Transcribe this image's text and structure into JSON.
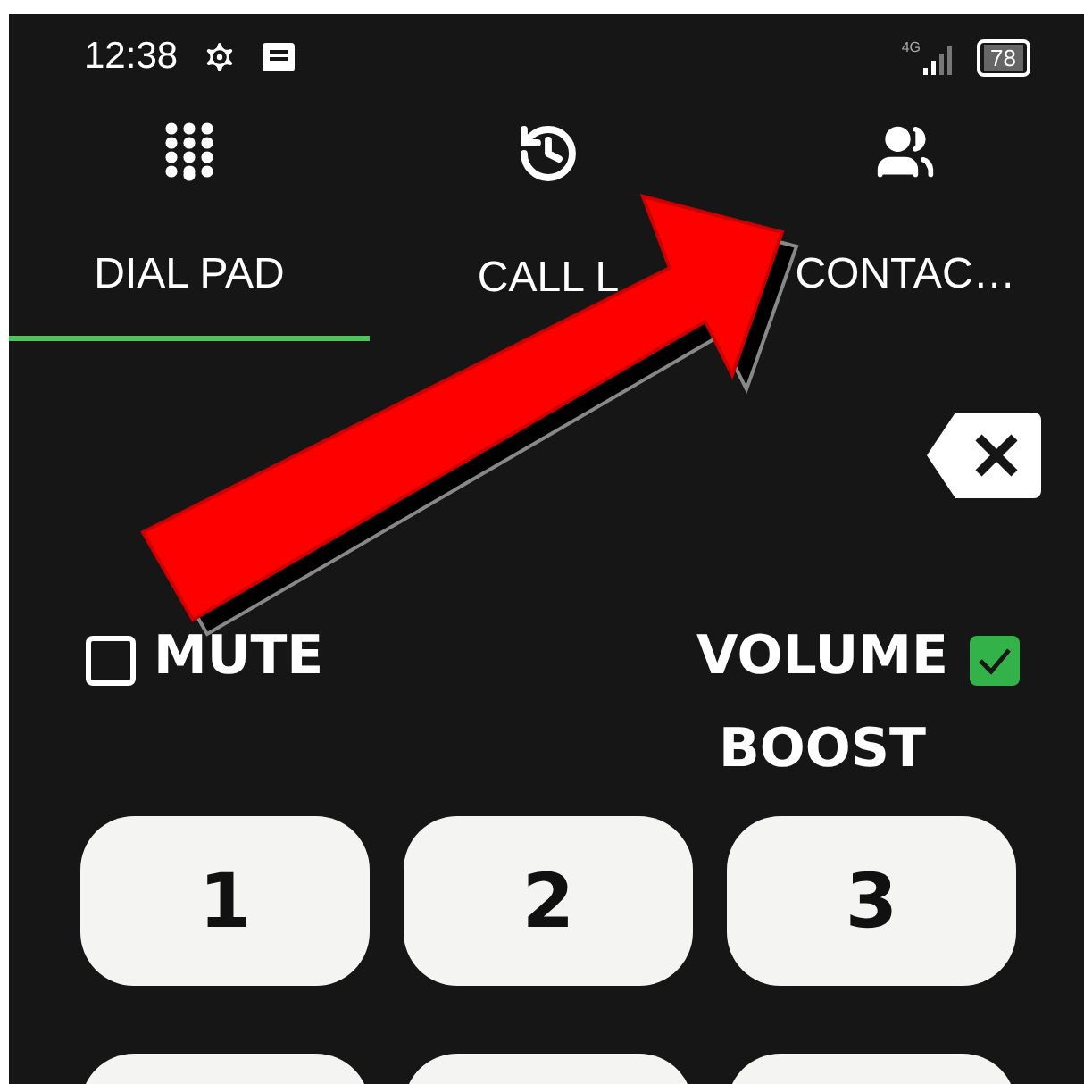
{
  "status_bar": {
    "time": "12:38",
    "network": "4G",
    "battery": "78"
  },
  "tabs": [
    {
      "label": "DIAL PAD",
      "selected": true
    },
    {
      "label": "CALL L",
      "selected": false
    },
    {
      "label": "CONTAC…",
      "selected": false
    }
  ],
  "options": [
    {
      "label": "MUTE",
      "checked": false
    },
    {
      "label": "VOLUME BOOST",
      "checked": true
    }
  ],
  "keys": [
    {
      "label": "1"
    },
    {
      "label": "2"
    },
    {
      "label": "3"
    }
  ]
}
